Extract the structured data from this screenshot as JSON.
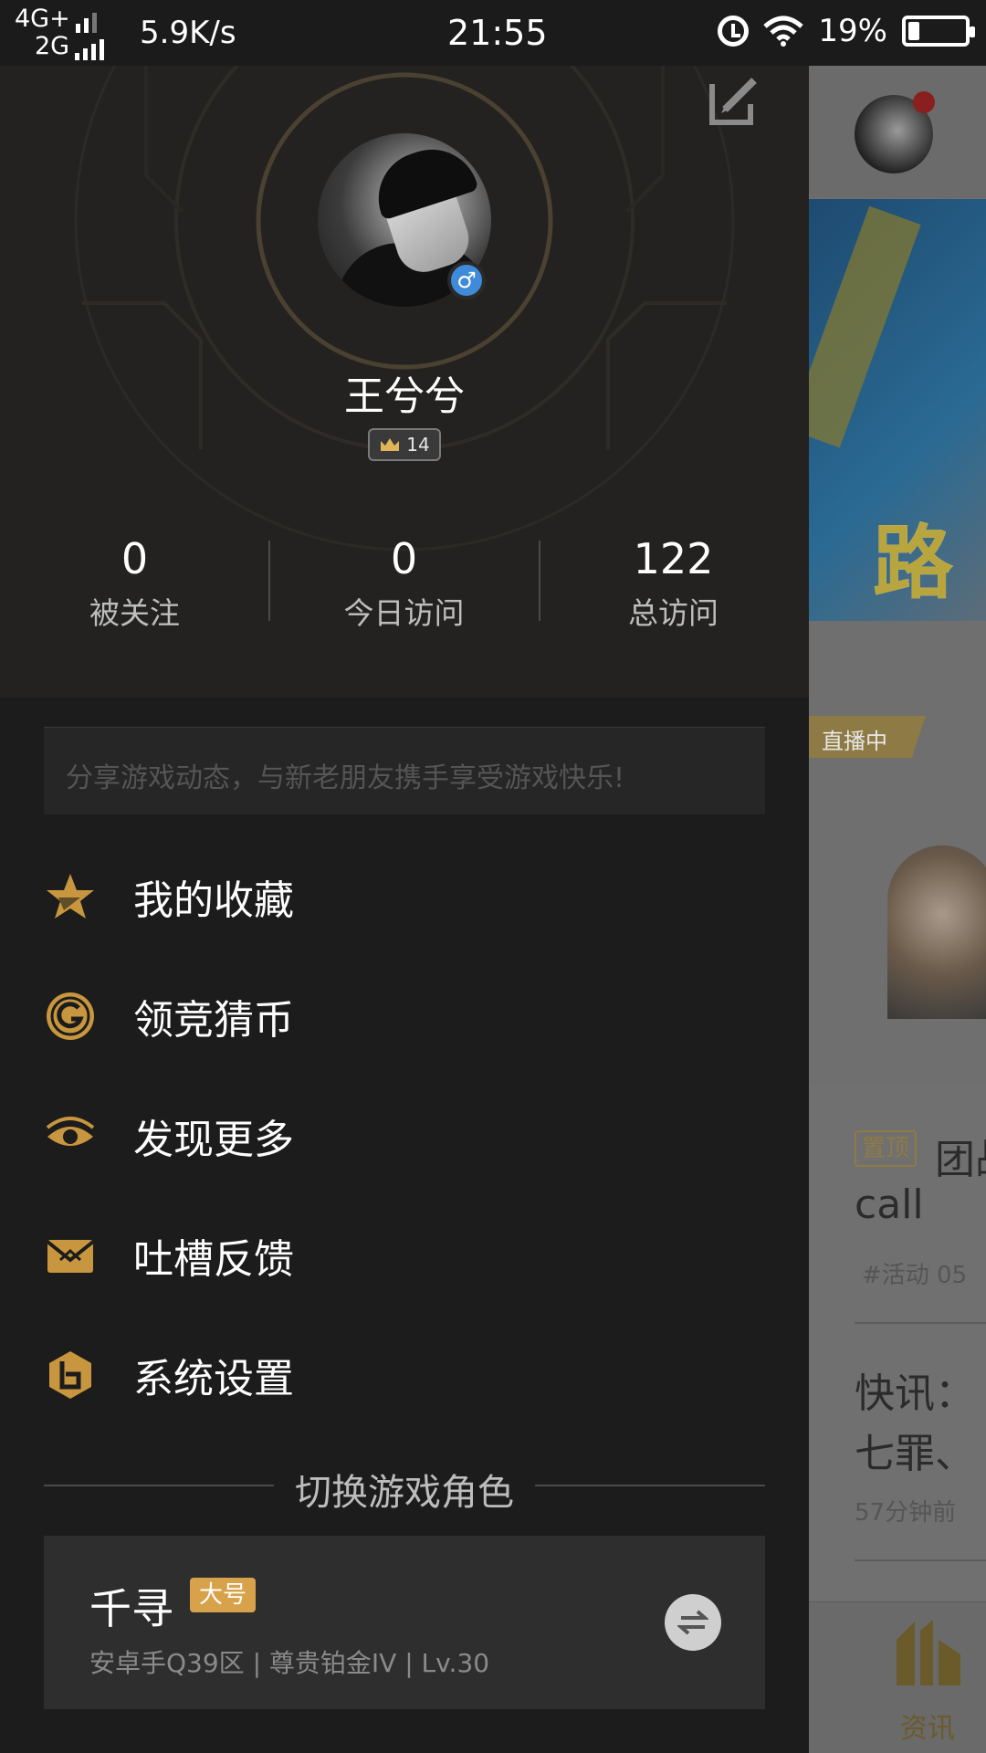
{
  "status_bar": {
    "network_top": "4G+",
    "network_bottom": "2G",
    "speed": "5.9K/s",
    "time": "21:55",
    "battery": "19%",
    "battery_level": 0.19
  },
  "profile": {
    "username": "王兮兮",
    "level": "14",
    "gender_symbol": "♂",
    "stats": [
      {
        "value": "0",
        "label": "被关注"
      },
      {
        "value": "0",
        "label": "今日访问"
      },
      {
        "value": "122",
        "label": "总访问"
      }
    ],
    "share_placeholder": "分享游戏动态，与新老朋友携手享受游戏快乐!"
  },
  "menu": [
    {
      "label": "我的收藏",
      "icon": "star-icon"
    },
    {
      "label": "领竞猜币",
      "icon": "coin-g-icon"
    },
    {
      "label": "发现更多",
      "icon": "eye-icon"
    },
    {
      "label": "吐槽反馈",
      "icon": "envelope-icon"
    },
    {
      "label": "系统设置",
      "icon": "settings-icon"
    }
  ],
  "role_switch": {
    "title": "切换游戏角色",
    "role_name": "千寻",
    "role_tag": "大号",
    "role_info": "安卓手Q39区 | 尊贵铂金IV | Lv.30"
  },
  "background_page": {
    "live_badge": "直播中",
    "pinned_tag": "置顶",
    "article1_title_partial": "团战",
    "article1_title_line2": "call",
    "article1_meta": "#活动   05",
    "article2_line1": "快讯：",
    "article2_line2": "七罪、",
    "article2_meta": "57分钟前",
    "banner_text": "路西",
    "nav_label": "资讯"
  },
  "colors": {
    "accent_gold": "#d8a24a",
    "drawer_bg": "#1c1c1c",
    "gender_blue": "#3f8bd9"
  }
}
